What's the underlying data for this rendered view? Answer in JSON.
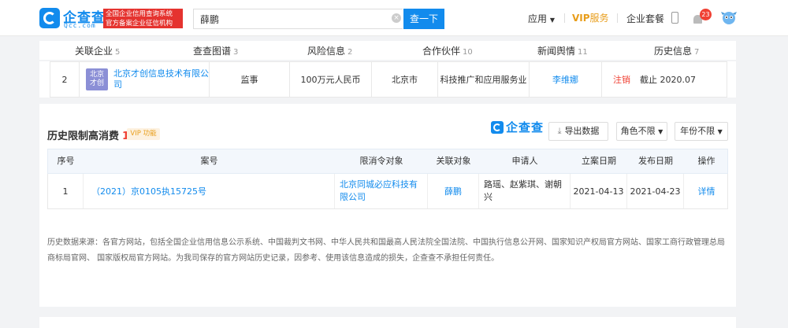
{
  "header": {
    "brand": "企查查",
    "brand_sub": "Qcc.com",
    "tag_line1": "全国企业信用查询系统",
    "tag_line2": "官方备案企业征信机构",
    "search_value": "薛鹏",
    "search_button": "查一下",
    "nav_app": "应用",
    "nav_vip": "VIP",
    "nav_vip_suffix": "服务",
    "nav_kit": "企业套餐",
    "bell_badge": "23"
  },
  "tabs": [
    {
      "label": "关联企业",
      "count": "5"
    },
    {
      "label": "查查图谱",
      "count": "3"
    },
    {
      "label": "风险信息",
      "count": "2"
    },
    {
      "label": "合作伙伴",
      "count": "10"
    },
    {
      "label": "新闻舆情",
      "count": "11"
    },
    {
      "label": "历史信息",
      "count": "7"
    }
  ],
  "partner_row": {
    "index": "2",
    "logo_text_1": "北京",
    "logo_text_2": "才创",
    "company": "北京才创信息技术有限公司",
    "role": "监事",
    "capital": "100万元人民币",
    "region": "北京市",
    "industry": "科技推广和应用服务业",
    "person": "李维娜",
    "status": "注销",
    "until": "截止 2020.07"
  },
  "section": {
    "title": "历史限制高消费",
    "count": "1",
    "vip_tag": "VIP 功能",
    "brand": "企查查",
    "export_button": "导出数据",
    "role_filter": "角色不限",
    "year_filter": "年份不限"
  },
  "table": {
    "headers": [
      "序号",
      "案号",
      "限消令对象",
      "关联对象",
      "申请人",
      "立案日期",
      "发布日期",
      "操作"
    ],
    "rows": [
      {
        "index": "1",
        "case_no": "（2021）京0105执15725号",
        "target": "北京同城必应科技有限公司",
        "related": "薛鹏",
        "applicant": "路瑶、赵紫琪、谢朝兴",
        "filed": "2021-04-13",
        "published": "2021-04-23",
        "action": "详情"
      }
    ]
  },
  "footnote": "历史数据来源：各官方网站，包括全国企业信用信息公示系统、中国裁判文书网、中华人民共和国最高人民法院全国法院、中国执行信息公开网、国家知识产权局官方网站、国家工商行政管理总局商标局官网、 国家版权局官方网站。为我司保存的官方网站历史记录，因参考、使用该信息造成的损失，企查查不承担任何责任。",
  "colors": {
    "brand_blue": "#128bed",
    "alert_red": "#f04134",
    "vip_gold": "#e89d1a"
  }
}
